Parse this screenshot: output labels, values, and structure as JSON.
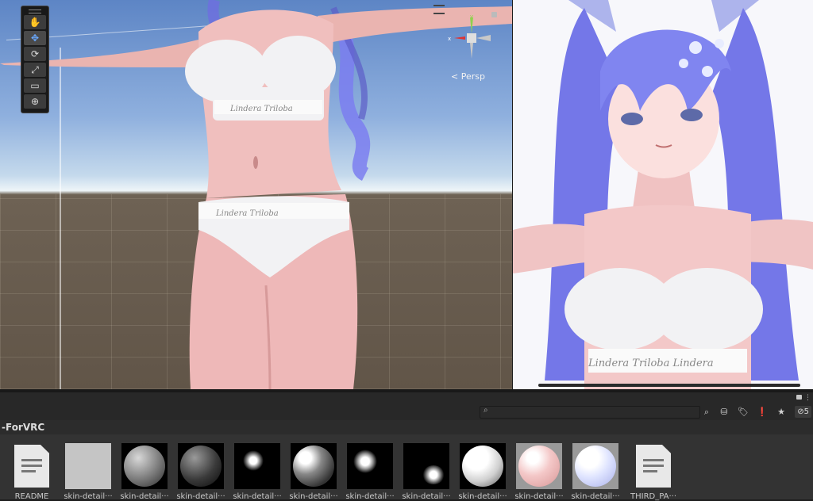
{
  "scene_view": {
    "camera_label": "< Persp",
    "gizmo_axes": {
      "x": "x",
      "y": "y"
    },
    "tools": [
      {
        "icon": "hand-icon",
        "glyph": "✋"
      },
      {
        "icon": "move-icon",
        "glyph": "✥"
      },
      {
        "icon": "rotate-icon",
        "glyph": "⟳"
      },
      {
        "icon": "scale-icon",
        "glyph": "⤢"
      },
      {
        "icon": "rect-tool-icon",
        "glyph": "▭"
      },
      {
        "icon": "transform-icon",
        "glyph": "⊕"
      }
    ]
  },
  "project": {
    "breadcrumb": "-ForVRC",
    "search": {
      "value": "",
      "placeholder": ""
    },
    "hidden_packages_count": "5",
    "assets": [
      {
        "label": "README",
        "type": "document"
      },
      {
        "label": "skin-detail···",
        "type": "texture-gray"
      },
      {
        "label": "skin-detail···",
        "type": "sphere-gray"
      },
      {
        "label": "skin-detail···",
        "type": "sphere-dark"
      },
      {
        "label": "skin-detail···",
        "type": "glow-small"
      },
      {
        "label": "skin-detail···",
        "type": "sphere-glow"
      },
      {
        "label": "skin-detail···",
        "type": "glow-medium"
      },
      {
        "label": "skin-detail···",
        "type": "glow-corner"
      },
      {
        "label": "skin-detail···",
        "type": "sphere-white"
      },
      {
        "label": "skin-detail···",
        "type": "sphere-pink"
      },
      {
        "label": "skin-detail···",
        "type": "sphere-blue"
      },
      {
        "label": "THIRD_PA···",
        "type": "document"
      }
    ]
  },
  "colors": {
    "editor_bg": "#282828",
    "accent_blue": "#6aa9ff",
    "hair": "#7b7ef0"
  }
}
